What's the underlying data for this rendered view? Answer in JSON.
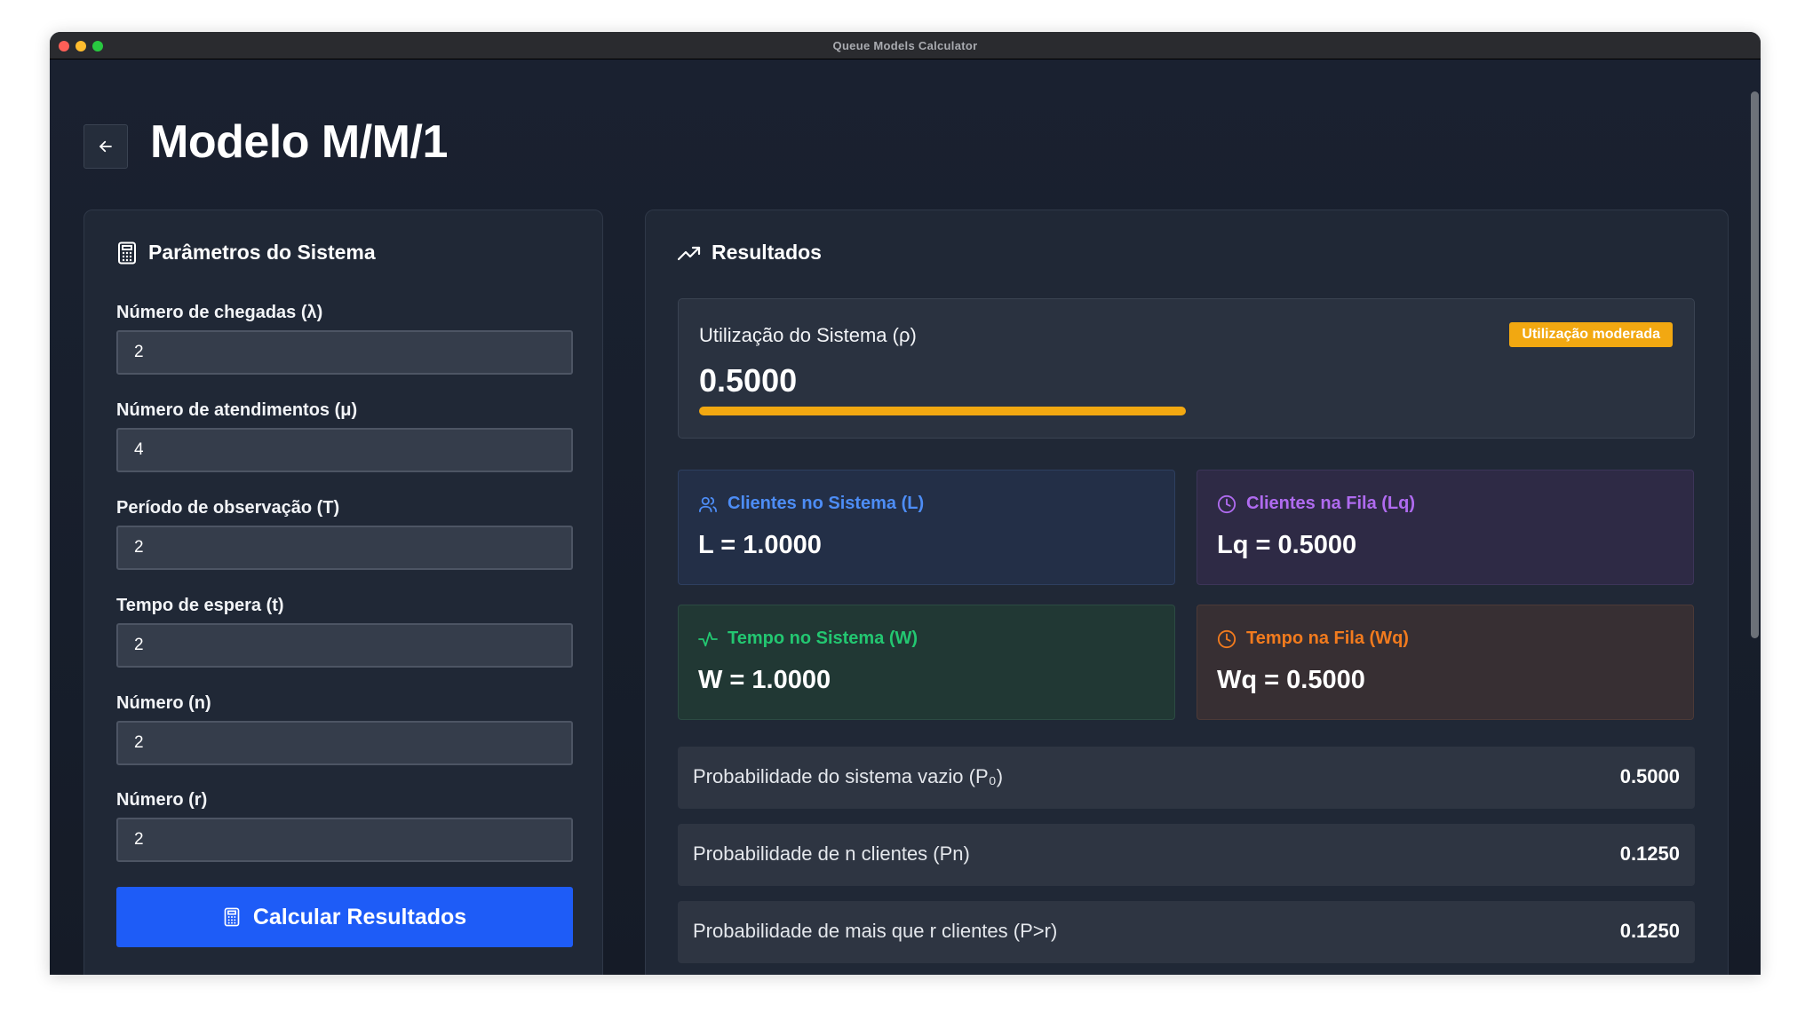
{
  "window": {
    "title": "Queue Models Calculator"
  },
  "header": {
    "title": "Modelo M/M/1",
    "back_icon": "arrow-left-icon"
  },
  "params": {
    "title": "Parâmetros do Sistema",
    "icon": "calculator-icon",
    "fields": [
      {
        "label": "Número de chegadas (λ)",
        "value": "2"
      },
      {
        "label": "Número de atendimentos (μ)",
        "value": "4"
      },
      {
        "label": "Período de observação (T)",
        "value": "2"
      },
      {
        "label": "Tempo de espera (t)",
        "value": "2"
      },
      {
        "label": "Número (n)",
        "value": "2"
      },
      {
        "label": "Número (r)",
        "value": "2"
      }
    ],
    "button_label": "Calcular Resultados"
  },
  "results": {
    "title": "Resultados",
    "icon": "trending-up-icon",
    "utilization": {
      "label": "Utilização do Sistema (ρ)",
      "value": "0.5000",
      "badge": "Utilização moderada",
      "progress_fraction": 0.5,
      "color": "#f2a811"
    },
    "metrics": {
      "L": {
        "label": "Clientes no Sistema (L)",
        "value": "L = 1.0000",
        "icon": "users-icon",
        "color": "#4d8df6"
      },
      "Lq": {
        "label": "Clientes na Fila (Lq)",
        "value": "Lq = 0.5000",
        "icon": "clock-icon",
        "color": "#b06bf0"
      },
      "W": {
        "label": "Tempo no Sistema (W)",
        "value": "W = 1.0000",
        "icon": "activity-icon",
        "color": "#23c771"
      },
      "Wq": {
        "label": "Tempo na Fila (Wq)",
        "value": "Wq = 0.5000",
        "icon": "clock-icon",
        "color": "#f27b1e"
      }
    },
    "probabilities": [
      {
        "label": "Probabilidade do sistema vazio (P₀)",
        "value": "0.5000"
      },
      {
        "label": "Probabilidade de n clientes (Pn)",
        "value": "0.1250"
      },
      {
        "label": "Probabilidade de mais que r clientes (P>r)",
        "value": "0.1250"
      },
      {
        "label": "",
        "value": ""
      }
    ]
  },
  "colors": {
    "primary_button": "#1e5cf7",
    "background": "#1b2130"
  }
}
